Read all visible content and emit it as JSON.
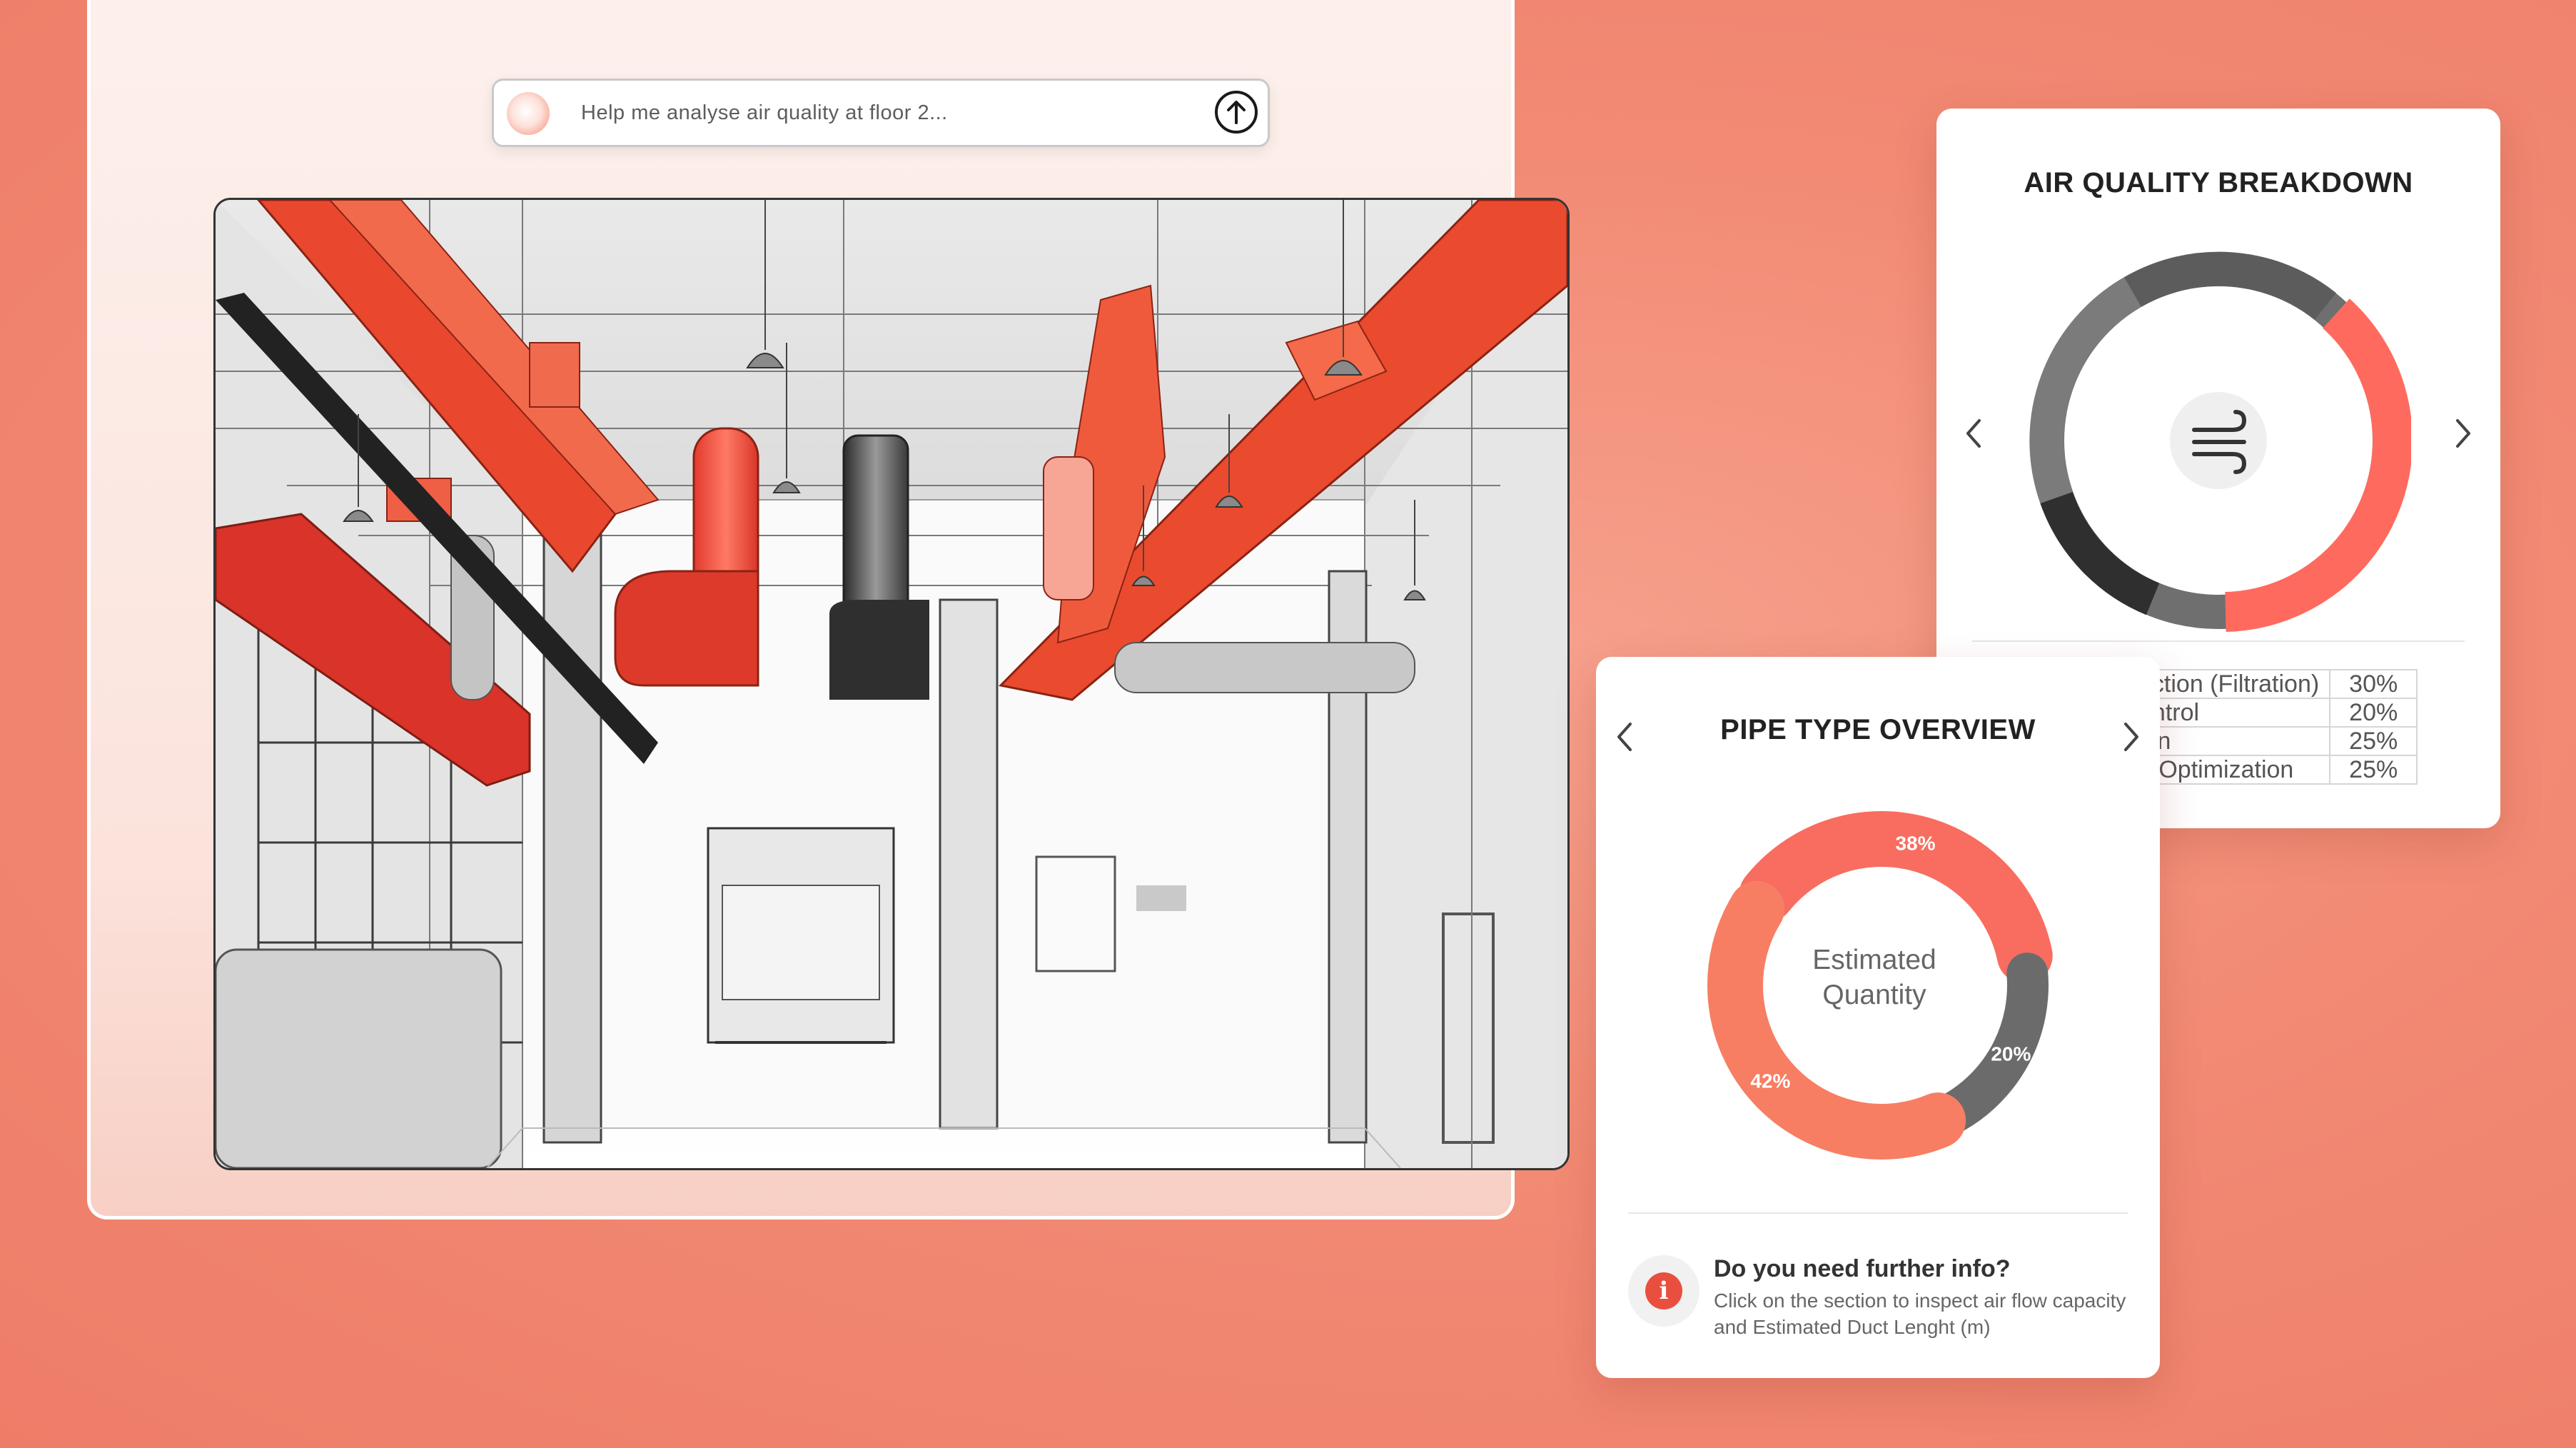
{
  "prompt": {
    "placeholder": "Help me analyse air quality at floor 2...",
    "icons": {
      "orb": "assistant-orb-icon",
      "send": "arrow-up-icon"
    }
  },
  "air_quality_card": {
    "title": "AIR QUALITY BREAKDOWN",
    "center_icon": "wind-icon",
    "nav_icons": {
      "prev": "chevron-left-icon",
      "next": "chevron-right-icon"
    },
    "rows": [
      {
        "label": "uction (Filtration)",
        "value": "30%"
      },
      {
        "label": "ontrol",
        "value": "20%"
      },
      {
        "label": "ion",
        "value": "25%"
      },
      {
        "label": "e Optimization",
        "value": "25%"
      }
    ],
    "ring_colors": [
      "#ff6a5e",
      "#2f2f2f",
      "#707070",
      "#5a5a5a"
    ]
  },
  "pipe_card": {
    "title": "PIPE TYPE OVERVIEW",
    "center_line1": "Estimated",
    "center_line2": "Quantity",
    "nav_icons": {
      "prev": "chevron-left-icon",
      "next": "chevron-right-icon"
    },
    "segments": [
      {
        "label": "38%",
        "value": 38,
        "color": "#f86d5f"
      },
      {
        "label": "20%",
        "value": 20,
        "color": "#6b6b6b"
      },
      {
        "label": "42%",
        "value": 42,
        "color": "#f77e63"
      }
    ],
    "info": {
      "icon": "info-icon",
      "title": "Do you need further info?",
      "body": "Click on the section to inspect air flow capacity and Estimated Duct  Lenght (m)"
    }
  }
}
